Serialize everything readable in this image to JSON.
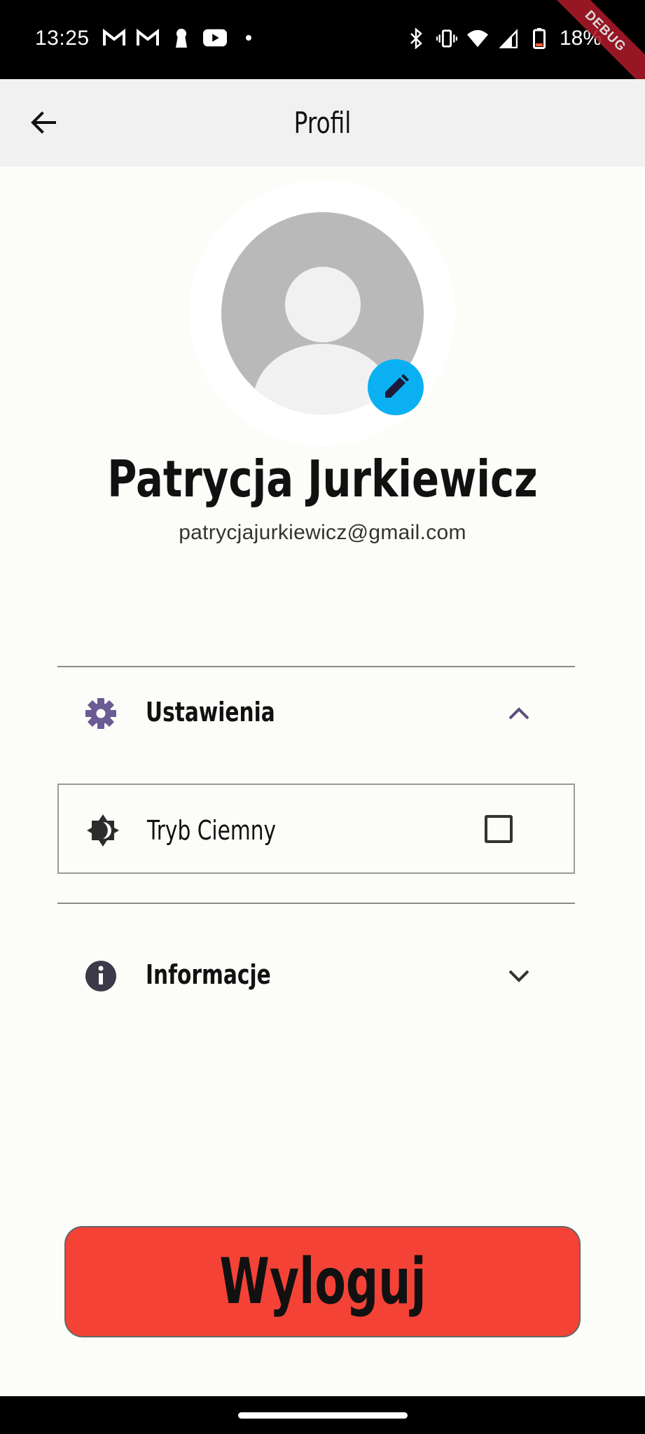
{
  "status_bar": {
    "time": "13:25",
    "left_icons": [
      "gmail-icon",
      "gmail-icon",
      "keyhole-icon",
      "youtube-icon",
      "dot-icon"
    ],
    "right_icons": [
      "bluetooth-icon",
      "vibrate-icon",
      "wifi-icon",
      "signal-icon",
      "battery-icon"
    ],
    "battery": "18%",
    "debug_banner": "DEBUG"
  },
  "app_bar": {
    "title": "Profil",
    "back_icon": "arrow-back-icon"
  },
  "profile": {
    "name": "Patrycja Jurkiewicz",
    "email": "patrycjajurkiewicz@gmail.com",
    "edit_icon": "pencil-icon",
    "edit_button_color": "#0bb0f3"
  },
  "sections": {
    "settings": {
      "label": "Ustawienia",
      "icon": "gear-icon",
      "icon_color": "#6b5b95",
      "expanded": true,
      "items": [
        {
          "label": "Tryb Ciemny",
          "icon": "brightness-icon",
          "checked": false
        }
      ]
    },
    "info": {
      "label": "Informacje",
      "icon": "info-icon",
      "expanded": false
    }
  },
  "logout": {
    "label": "Wyloguj",
    "color": "#f44336"
  }
}
